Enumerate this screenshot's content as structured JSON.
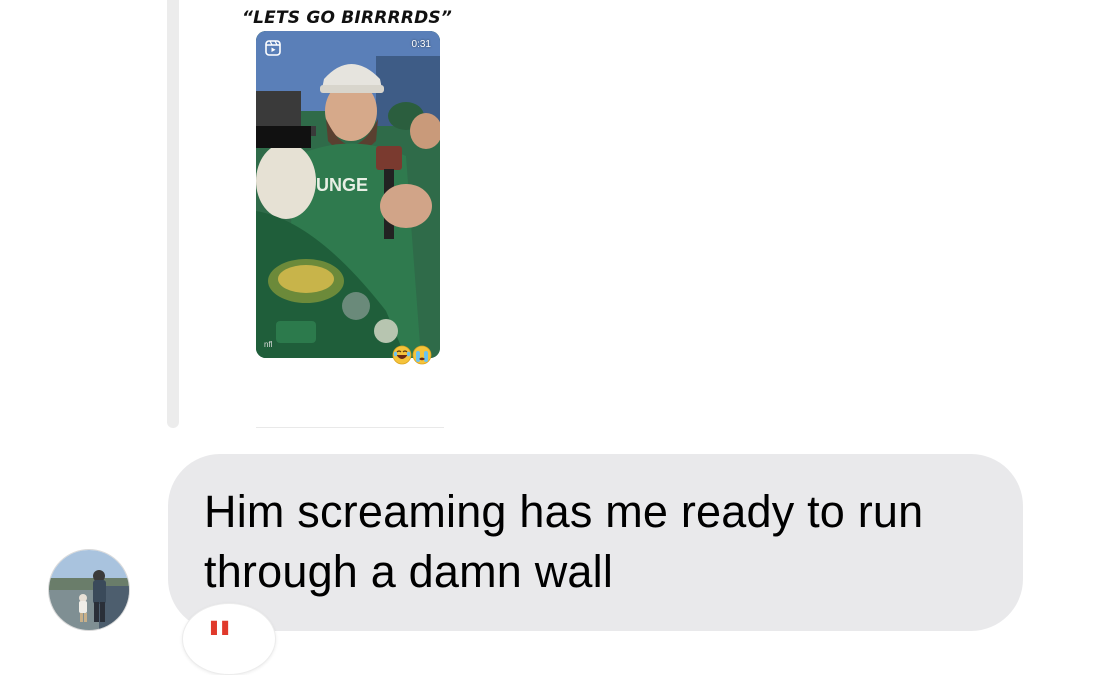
{
  "reply": {
    "caption": "“LETS GO BIRRRRDS”",
    "reel": {
      "icon": "reels-icon",
      "duration": "0:31",
      "credit": "nfl"
    },
    "reactions": [
      "😂",
      "😭"
    ]
  },
  "message": {
    "text": "Him screaming has me ready to run through a damn wall",
    "avatar": "profile-photo-avatar"
  },
  "quote_badge": {
    "icon": "quote-icon",
    "glyph": "\""
  },
  "colors": {
    "bubble": "#e9e9eb",
    "reply_bar": "#ececec",
    "quote_red": "#e0392b"
  }
}
